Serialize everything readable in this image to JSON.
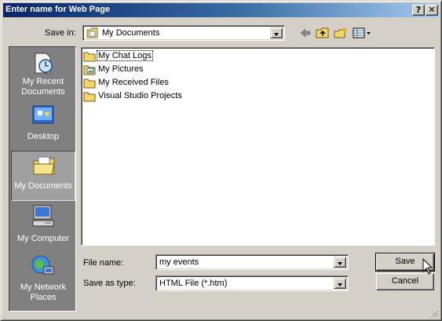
{
  "window": {
    "title": "Enter name for Web Page"
  },
  "title_buttons": {
    "help": "?",
    "close": "✕"
  },
  "save_in": {
    "label": "Save in:",
    "value": "My Documents"
  },
  "toolbar": [
    "back-icon",
    "up-folder-icon",
    "new-folder-icon",
    "view-menu-icon"
  ],
  "places": [
    {
      "label": "My Recent Documents",
      "icon": "recent-documents-icon"
    },
    {
      "label": "Desktop",
      "icon": "desktop-icon"
    },
    {
      "label": "My Documents",
      "icon": "my-documents-icon",
      "selected": true
    },
    {
      "label": "My Computer",
      "icon": "my-computer-icon"
    },
    {
      "label": "My Network Places",
      "icon": "network-places-icon"
    }
  ],
  "files": [
    {
      "name": "My Chat Logs",
      "icon": "folder-icon",
      "focused": true
    },
    {
      "name": "My Pictures",
      "icon": "pictures-folder-icon"
    },
    {
      "name": "My Received Files",
      "icon": "folder-icon"
    },
    {
      "name": "Visual Studio Projects",
      "icon": "folder-icon"
    }
  ],
  "file_name": {
    "label": "File name:",
    "value": "my events"
  },
  "save_as_type": {
    "label": "Save as type:",
    "value": "HTML File (*.htm)"
  },
  "buttons": {
    "save": "Save",
    "cancel": "Cancel"
  },
  "colors": {
    "title_start": "#0a246a",
    "title_end": "#a6caf0",
    "face": "#d4d0c8",
    "places_bg": "#808080"
  }
}
